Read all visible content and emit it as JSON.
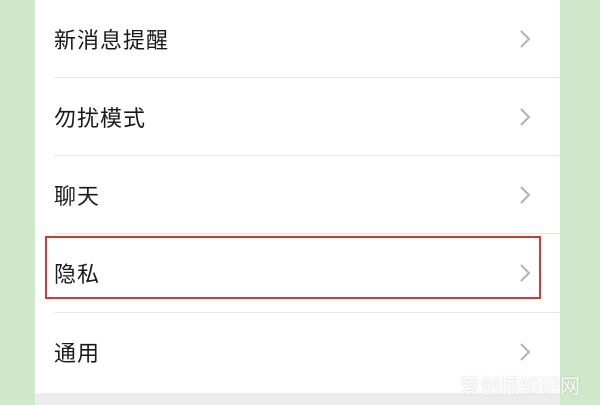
{
  "settings": {
    "items": [
      {
        "label": "新消息提醒",
        "icon": "chevron-right-icon"
      },
      {
        "label": "勿扰模式",
        "icon": "chevron-right-icon"
      },
      {
        "label": "聊天",
        "icon": "chevron-right-icon"
      },
      {
        "label": "隐私",
        "icon": "chevron-right-icon",
        "highlighted": true
      },
      {
        "label": "通用",
        "icon": "chevron-right-icon"
      }
    ]
  },
  "watermark": {
    "text": "爱创根知识网"
  },
  "colors": {
    "background": "#cfe8c9",
    "panel": "#ffffff",
    "highlight_border": "#d23a32",
    "chevron": "#b3b3b3"
  }
}
